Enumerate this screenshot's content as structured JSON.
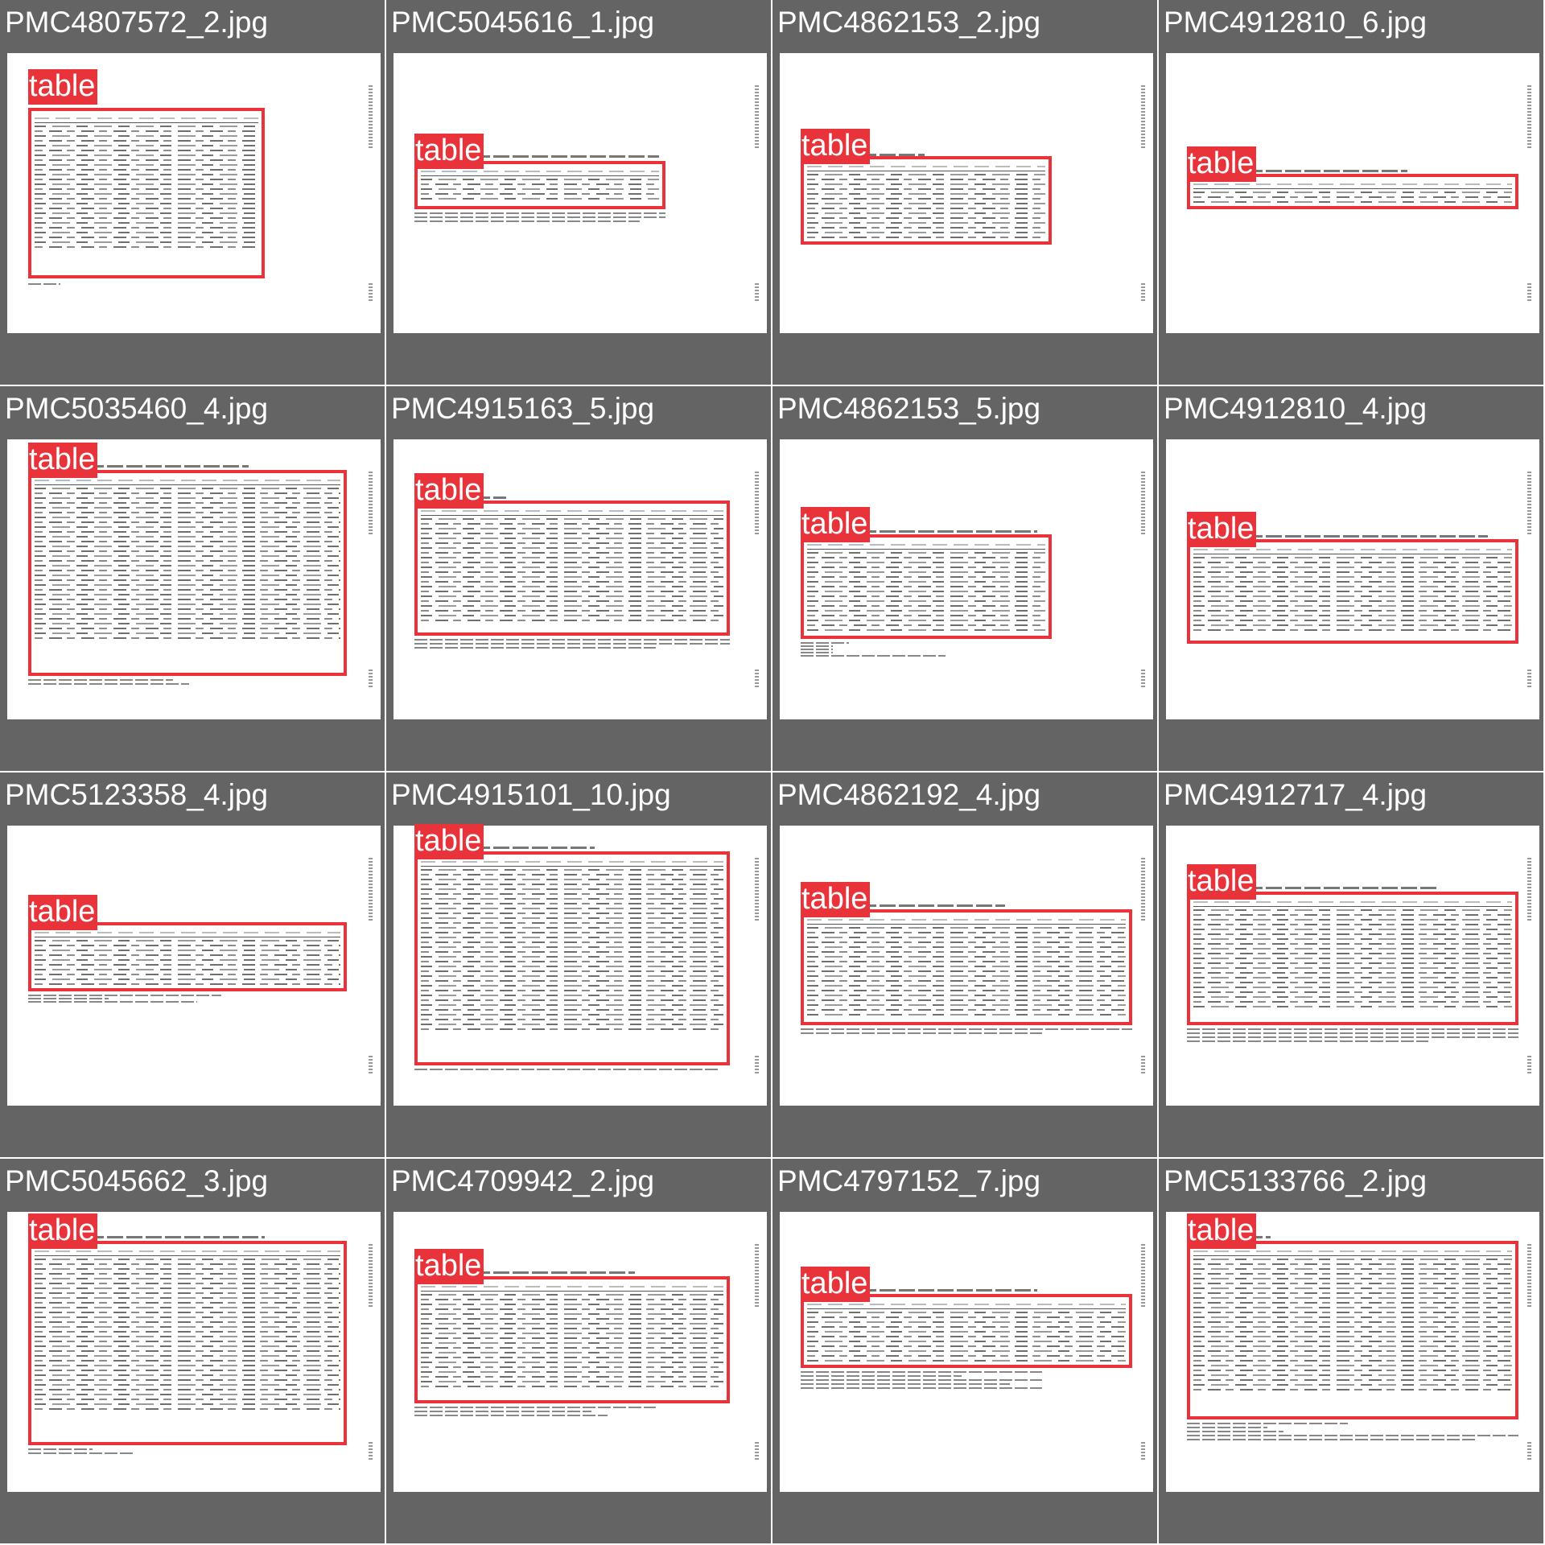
{
  "accent_color": "#e8333b",
  "label_background_color": "#646464",
  "cells": [
    {
      "filename": "PMC4807572_2.jpg",
      "label": "table"
    },
    {
      "filename": "PMC5045616_1.jpg",
      "label": "table"
    },
    {
      "filename": "PMC4862153_2.jpg",
      "label": "table"
    },
    {
      "filename": "PMC4912810_6.jpg",
      "label": "table"
    },
    {
      "filename": "PMC5035460_4.jpg",
      "label": "table"
    },
    {
      "filename": "PMC4915163_5.jpg",
      "label": "table"
    },
    {
      "filename": "PMC4862153_5.jpg",
      "label": "table"
    },
    {
      "filename": "PMC4912810_4.jpg",
      "label": "table"
    },
    {
      "filename": "PMC5123358_4.jpg",
      "label": "table"
    },
    {
      "filename": "PMC4915101_10.jpg",
      "label": "table"
    },
    {
      "filename": "PMC4862192_4.jpg",
      "label": "table"
    },
    {
      "filename": "PMC4912717_4.jpg",
      "label": "table"
    },
    {
      "filename": "PMC5045662_3.jpg",
      "label": "table"
    },
    {
      "filename": "PMC4709942_2.jpg",
      "label": "table"
    },
    {
      "filename": "PMC4797152_7.jpg",
      "label": "table"
    },
    {
      "filename": "PMC5133766_2.jpg",
      "label": "table"
    }
  ]
}
